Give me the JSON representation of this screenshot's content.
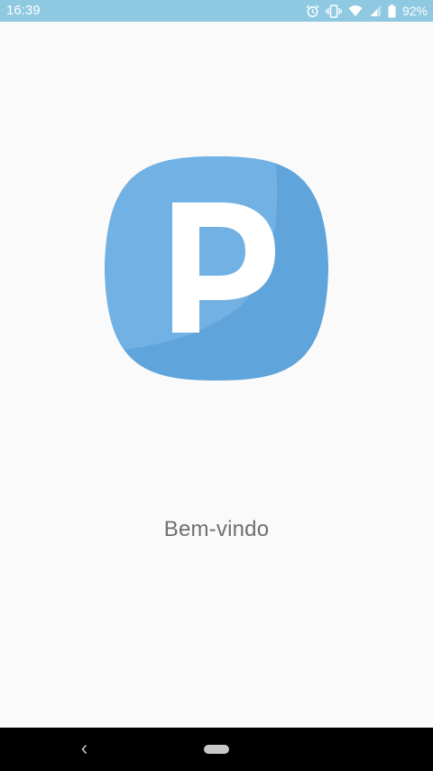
{
  "status_bar": {
    "time": "16:39",
    "battery_percent": "92%",
    "icons": [
      "alarm-icon",
      "vibrate-icon",
      "wifi-icon",
      "cell-signal-icon",
      "battery-icon"
    ],
    "background_color": "#8ec9e1"
  },
  "logo": {
    "letter": "P",
    "color": "#64a7dd"
  },
  "welcome": {
    "text": "Bem-vindo"
  },
  "nav_bar": {
    "buttons": [
      "back-button",
      "home-button"
    ]
  }
}
